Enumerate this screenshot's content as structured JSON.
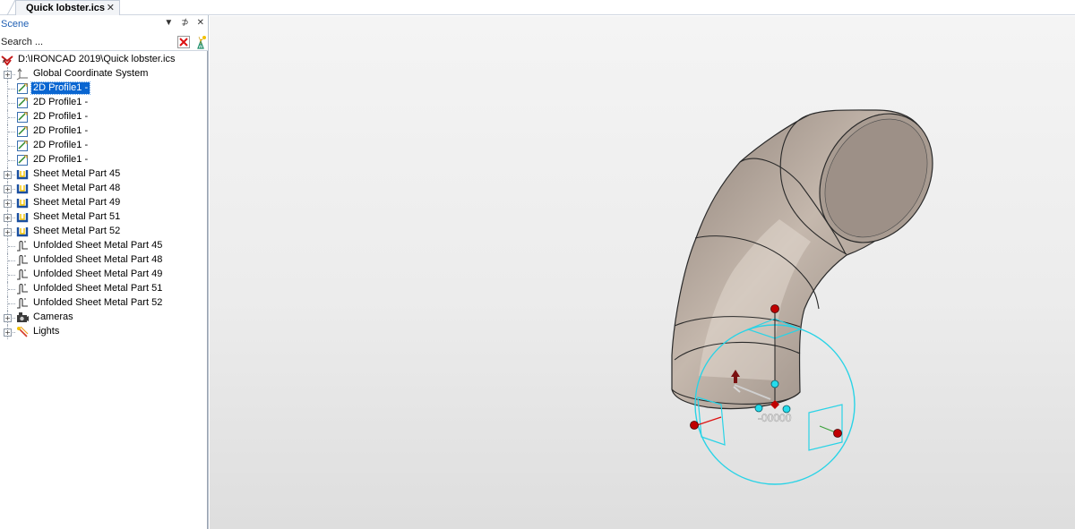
{
  "document_tab": {
    "title": "Quick lobster.ics",
    "close_glyph": "✕"
  },
  "scene_panel": {
    "title": "Scene",
    "controls": {
      "dropdown": "▼",
      "pin": "⊅",
      "close": "✕"
    },
    "search": {
      "placeholder": "Search ..."
    },
    "tree": [
      {
        "label": "D:\\IRONCAD 2019\\Quick lobster.ics",
        "icon": "scene-root-icon",
        "level": 0,
        "expander": false,
        "selected": false
      },
      {
        "label": "Global Coordinate System",
        "icon": "coordinate-system-icon",
        "level": 1,
        "expander": true,
        "selected": false
      },
      {
        "label": "2D Profile1 -",
        "icon": "profile-sketch-icon",
        "level": 1,
        "expander": false,
        "selected": true
      },
      {
        "label": "2D Profile1 -",
        "icon": "profile-sketch-icon",
        "level": 1,
        "expander": false,
        "selected": false
      },
      {
        "label": "2D Profile1 -",
        "icon": "profile-sketch-icon",
        "level": 1,
        "expander": false,
        "selected": false
      },
      {
        "label": "2D Profile1 -",
        "icon": "profile-sketch-icon",
        "level": 1,
        "expander": false,
        "selected": false
      },
      {
        "label": "2D Profile1 -",
        "icon": "profile-sketch-icon",
        "level": 1,
        "expander": false,
        "selected": false
      },
      {
        "label": "2D Profile1 -",
        "icon": "profile-sketch-icon",
        "level": 1,
        "expander": false,
        "selected": false
      },
      {
        "label": "Sheet Metal Part 45",
        "icon": "sheet-metal-part-icon",
        "level": 1,
        "expander": true,
        "selected": false
      },
      {
        "label": "Sheet Metal Part 48",
        "icon": "sheet-metal-part-icon",
        "level": 1,
        "expander": true,
        "selected": false
      },
      {
        "label": "Sheet Metal Part 49",
        "icon": "sheet-metal-part-icon",
        "level": 1,
        "expander": true,
        "selected": false
      },
      {
        "label": "Sheet Metal Part 51",
        "icon": "sheet-metal-part-icon",
        "level": 1,
        "expander": true,
        "selected": false
      },
      {
        "label": "Sheet Metal Part 52",
        "icon": "sheet-metal-part-icon",
        "level": 1,
        "expander": true,
        "selected": false
      },
      {
        "label": "Unfolded Sheet Metal Part 45",
        "icon": "unfolded-sheet-metal-icon",
        "level": 1,
        "expander": false,
        "selected": false
      },
      {
        "label": "Unfolded Sheet Metal Part 48",
        "icon": "unfolded-sheet-metal-icon",
        "level": 1,
        "expander": false,
        "selected": false
      },
      {
        "label": "Unfolded Sheet Metal Part 49",
        "icon": "unfolded-sheet-metal-icon",
        "level": 1,
        "expander": false,
        "selected": false
      },
      {
        "label": "Unfolded Sheet Metal Part 51",
        "icon": "unfolded-sheet-metal-icon",
        "level": 1,
        "expander": false,
        "selected": false
      },
      {
        "label": "Unfolded Sheet Metal Part 52",
        "icon": "unfolded-sheet-metal-icon",
        "level": 1,
        "expander": false,
        "selected": false
      },
      {
        "label": "Cameras",
        "icon": "camera-icon",
        "level": 1,
        "expander": true,
        "selected": false
      },
      {
        "label": "Lights",
        "icon": "light-icon",
        "level": 1,
        "expander": true,
        "selected": false
      }
    ]
  },
  "viewport": {
    "dimension_readout": "-00000",
    "colors": {
      "part_fill": "#b3a69c",
      "selection_accent": "#0a66d1",
      "triball_ring": "#29d3e6",
      "handle_red": "#c00000",
      "handle_cyan": "#24dcec"
    }
  }
}
